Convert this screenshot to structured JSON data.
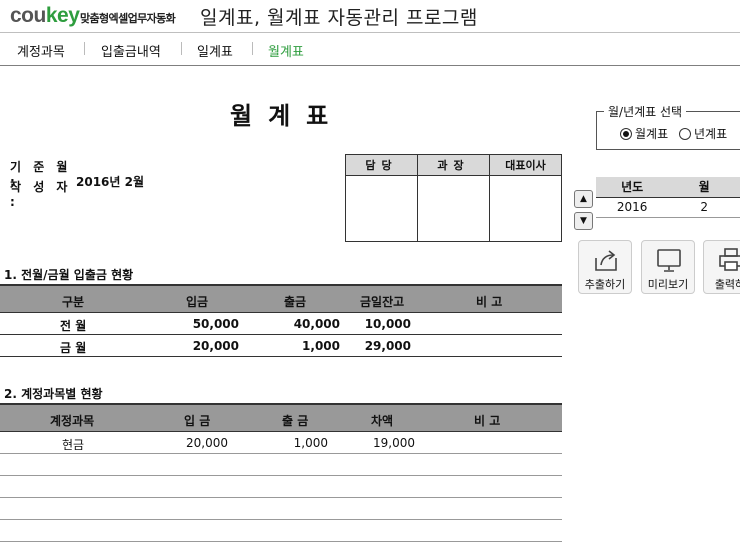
{
  "header": {
    "logo_main": "cou",
    "logo_accent": "key",
    "logo_tagline": "맞춤형엑셀업무자동화",
    "title": "일계표, 월계표 자동관리 프로그램"
  },
  "menu": {
    "items": [
      {
        "label": "계정과목"
      },
      {
        "label": "입출금내역"
      },
      {
        "label": "일계표"
      },
      {
        "label": "월계표"
      }
    ]
  },
  "report": {
    "title": "월계표",
    "base_month_label": "기 준 월 :",
    "base_month_value": "2016년 2월",
    "author_label": "작 성 자 :",
    "author_value": ""
  },
  "approval": {
    "headers": [
      "담당",
      "과장",
      "대표이사"
    ]
  },
  "selector": {
    "legend": "월/년계표 선택",
    "options": [
      "월계표",
      "년계표"
    ],
    "selected": "월계표"
  },
  "period": {
    "headers": [
      "년도",
      "월"
    ],
    "year": "2016",
    "month": "2"
  },
  "tools": {
    "export": "추출하기",
    "preview": "미리보기",
    "print": "출력하"
  },
  "section1": {
    "title": "1. 전월/금월 입출금 현황",
    "headers": [
      "구분",
      "입금",
      "출금",
      "금일잔고",
      "비 고"
    ],
    "rows": [
      {
        "label": "전 월",
        "deposit": "50,000",
        "withdrawal": "40,000",
        "balance": "10,000"
      },
      {
        "label": "금 월",
        "deposit": "20,000",
        "withdrawal": "1,000",
        "balance": "29,000"
      }
    ]
  },
  "section2": {
    "title": "2. 계정과목별 현황",
    "headers": [
      "계정과목",
      "입 금",
      "출 금",
      "차액",
      "비 고"
    ],
    "rows": [
      {
        "account": "현금",
        "deposit": "20,000",
        "withdrawal": "1,000",
        "diff": "19,000"
      }
    ]
  }
}
